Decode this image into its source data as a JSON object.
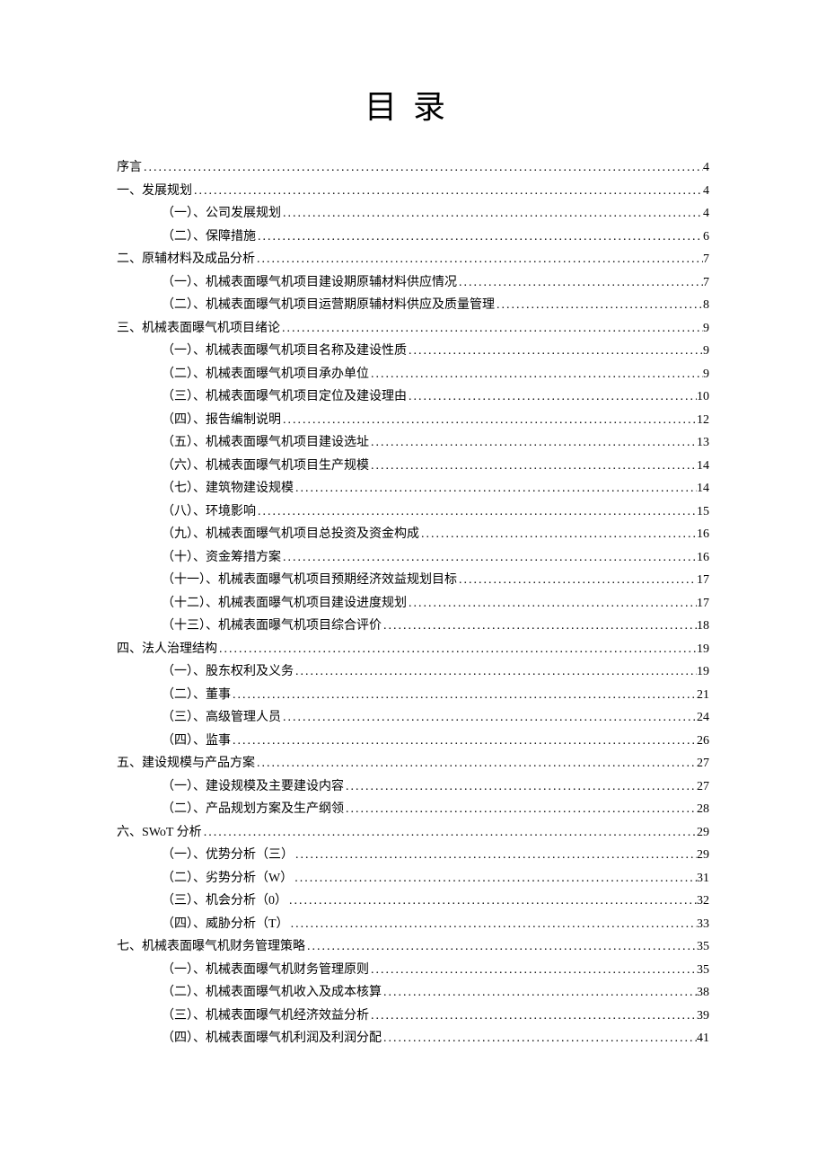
{
  "title": "目录",
  "entries": [
    {
      "level": 1,
      "label": "序言",
      "page": "4"
    },
    {
      "level": 1,
      "label": "一、发展规划",
      "page": "4"
    },
    {
      "level": 2,
      "label": "（一）、公司发展规划",
      "page": "4"
    },
    {
      "level": 2,
      "label": "（二）、保障措施",
      "page": "6"
    },
    {
      "level": 1,
      "label": "二、原辅材料及成品分析",
      "page": "7"
    },
    {
      "level": 2,
      "label": "（一）、机械表面曝气机项目建设期原辅材料供应情况",
      "page": "7"
    },
    {
      "level": 2,
      "label": "（二）、机械表面曝气机项目运营期原辅材料供应及质量管理",
      "page": "8"
    },
    {
      "level": 1,
      "label": "三、机械表面曝气机项目绪论",
      "page": "9"
    },
    {
      "level": 2,
      "label": "（一）、机械表面曝气机项目名称及建设性质",
      "page": "9"
    },
    {
      "level": 2,
      "label": "（二）、机械表面曝气机项目承办单位",
      "page": "9"
    },
    {
      "level": 2,
      "label": "（三）、机械表面曝气机项目定位及建设理由",
      "page": "10"
    },
    {
      "level": 2,
      "label": "（四）、报告编制说明",
      "page": "12"
    },
    {
      "level": 2,
      "label": "（五）、机械表面曝气机项目建设选址",
      "page": "13"
    },
    {
      "level": 2,
      "label": "（六）、机械表面曝气机项目生产规模",
      "page": "14"
    },
    {
      "level": 2,
      "label": "（七）、建筑物建设规模",
      "page": "14"
    },
    {
      "level": 2,
      "label": "（八）、环境影响",
      "page": "15"
    },
    {
      "level": 2,
      "label": "（九）、机械表面曝气机项目总投资及资金构成",
      "page": "16"
    },
    {
      "level": 2,
      "label": "（十）、资金筹措方案",
      "page": "16"
    },
    {
      "level": 2,
      "label": "（十一）、机械表面曝气机项目预期经济效益规划目标",
      "page": "17"
    },
    {
      "level": 2,
      "label": "（十二）、机械表面曝气机项目建设进度规划",
      "page": "17"
    },
    {
      "level": 2,
      "label": "（十三）、机械表面曝气机项目综合评价",
      "page": "18"
    },
    {
      "level": 1,
      "label": "四、法人治理结构",
      "page": "19"
    },
    {
      "level": 2,
      "label": "（一）、股东权利及义务",
      "page": "19"
    },
    {
      "level": 2,
      "label": "（二）、董事",
      "page": "21"
    },
    {
      "level": 2,
      "label": "（三）、高级管理人员",
      "page": "24"
    },
    {
      "level": 2,
      "label": "（四）、监事",
      "page": "26"
    },
    {
      "level": 1,
      "label": "五、建设规模与产品方案",
      "page": "27"
    },
    {
      "level": 2,
      "label": "（一）、建设规模及主要建设内容",
      "page": "27"
    },
    {
      "level": 2,
      "label": "（二）、产品规划方案及生产纲领",
      "page": "28"
    },
    {
      "level": 1,
      "label": "六、SWoT 分析",
      "page": "29"
    },
    {
      "level": 2,
      "label": "（一）、优势分析（三）",
      "page": "29"
    },
    {
      "level": 2,
      "label": "（二）、劣势分析（W）",
      "page": "31"
    },
    {
      "level": 2,
      "label": "（三）、机会分析（0）",
      "page": "32"
    },
    {
      "level": 2,
      "label": "（四）、威胁分析（T）",
      "page": "33"
    },
    {
      "level": 1,
      "label": "七、机械表面曝气机财务管理策略",
      "page": "35"
    },
    {
      "level": 2,
      "label": "（一）、机械表面曝气机财务管理原则",
      "page": "35"
    },
    {
      "level": 2,
      "label": "（二）、机械表面曝气机收入及成本核算",
      "page": "38"
    },
    {
      "level": 2,
      "label": "（三）、机械表面曝气机经济效益分析",
      "page": "39"
    },
    {
      "level": 2,
      "label": "（四）、机械表面曝气机利润及利润分配",
      "page": "41"
    }
  ]
}
